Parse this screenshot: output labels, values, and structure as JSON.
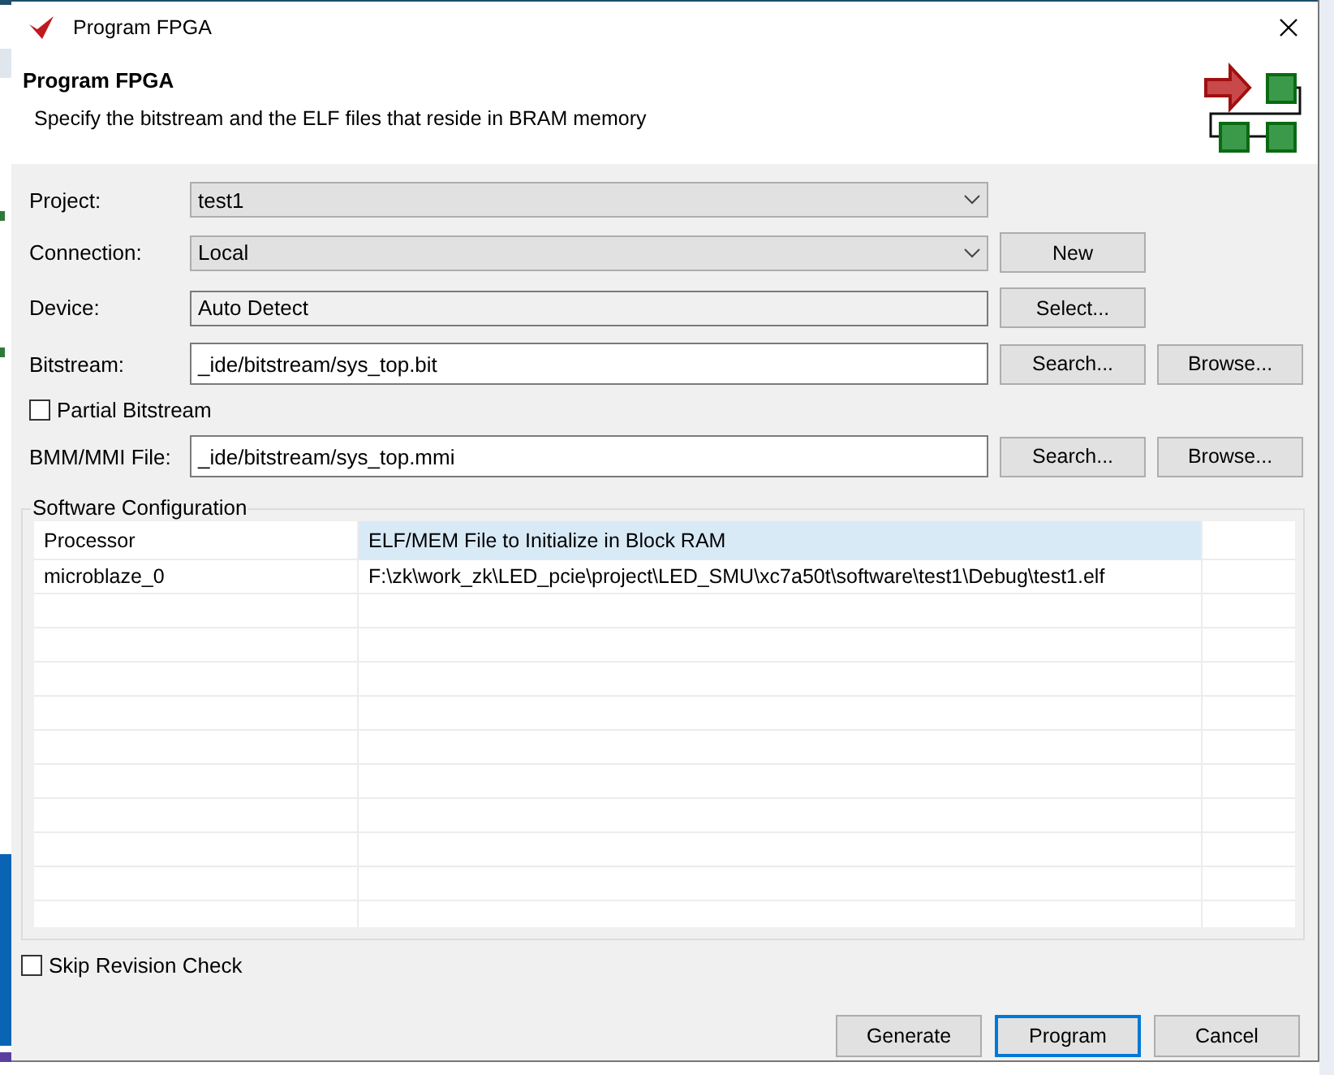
{
  "window": {
    "title": "Program FPGA"
  },
  "header": {
    "title": "Program FPGA",
    "description": "Specify the bitstream and the ELF files that reside in BRAM memory"
  },
  "fields": [
    {
      "kind": "dropdown",
      "label": "Project:",
      "value": "test1"
    },
    {
      "kind": "dropdown",
      "label": "Connection:",
      "value": "Local",
      "buttons": [
        "New"
      ]
    },
    {
      "kind": "readonly",
      "label": "Device:",
      "value": "Auto Detect",
      "buttons": [
        "Select..."
      ]
    },
    {
      "kind": "text",
      "label": "Bitstream:",
      "value": "_ide/bitstream/sys_top.bit",
      "buttons": [
        "Search...",
        "Browse..."
      ]
    },
    {
      "kind": "checkbox",
      "label": "Partial Bitstream",
      "checked": false
    },
    {
      "kind": "text",
      "label": "BMM/MMI File:",
      "value": "_ide/bitstream/sys_top.mmi",
      "buttons": [
        "Search...",
        "Browse..."
      ]
    }
  ],
  "software_configuration": {
    "title": "Software Configuration",
    "columns": [
      {
        "label": "Processor",
        "selected": false
      },
      {
        "label": "ELF/MEM File to Initialize in Block RAM",
        "selected": true
      }
    ],
    "rows": [
      [
        "microblaze_0",
        "F:\\zk\\work_zk\\LED_pcie\\project\\LED_SMU\\xc7a50t\\software\\test1\\Debug\\test1.elf"
      ]
    ]
  },
  "skip_revision_check": {
    "label": "Skip Revision Check",
    "checked": false
  },
  "buttons": [
    {
      "label": "Generate",
      "default": false
    },
    {
      "label": "Program",
      "default": true
    },
    {
      "label": "Cancel",
      "default": false
    }
  ]
}
